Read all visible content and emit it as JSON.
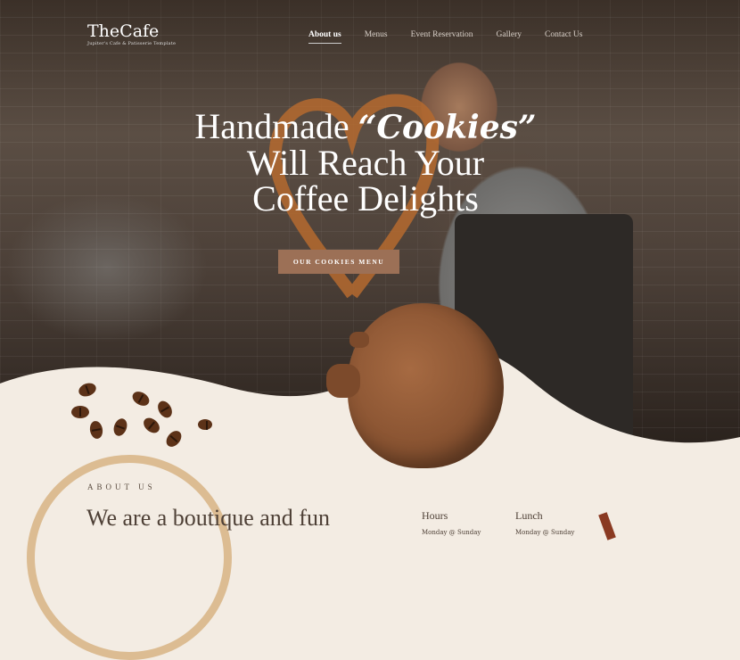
{
  "logo": {
    "name": "TheCafe",
    "tagline": "Jupiter's Cafe & Patisserie Template"
  },
  "nav": {
    "items": [
      {
        "label": "About us",
        "active": true
      },
      {
        "label": "Menus"
      },
      {
        "label": "Event Reservation"
      },
      {
        "label": "Gallery"
      },
      {
        "label": "Contact Us"
      }
    ]
  },
  "hero": {
    "line1": "Handmade",
    "highlight": "“Cookies”",
    "line2": "Will Reach Your",
    "line3": "Coffee Delights",
    "cta": "OUR COOKIES MENU"
  },
  "about": {
    "label": "ABOUT US",
    "title": "We are a boutique and fun"
  },
  "hours": {
    "title": "Hours",
    "text": "Monday @ Sunday"
  },
  "lunch": {
    "title": "Lunch",
    "text": "Monday @ Sunday"
  },
  "colors": {
    "accent": "#9c7056",
    "heart": "#b56a2f",
    "paper": "#f3ece3"
  }
}
